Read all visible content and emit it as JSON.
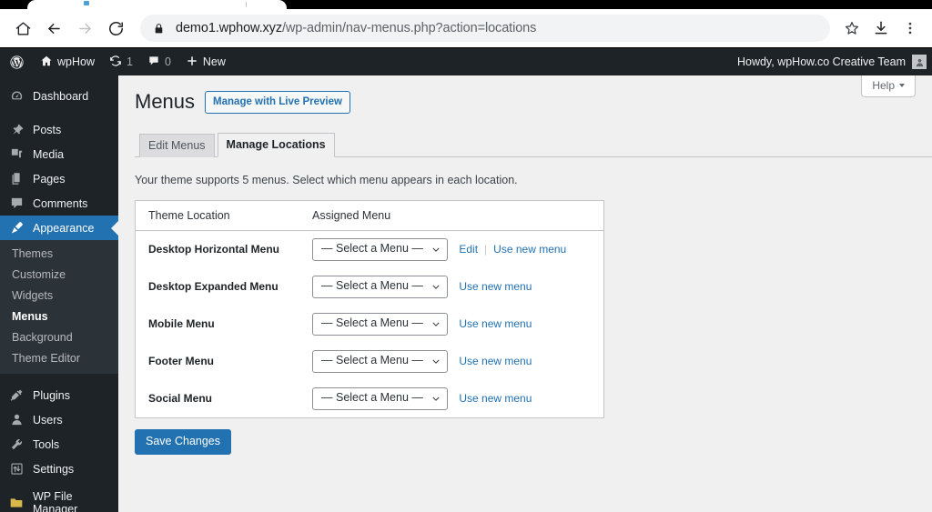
{
  "browser": {
    "url_host": "demo1.wphow.xyz",
    "url_path": "/wp-admin/nav-menus.php?action=locations",
    "icons": {
      "home": "home-icon",
      "back": "back-arrow-icon",
      "forward": "forward-arrow-icon",
      "reload": "reload-icon",
      "lock": "lock-icon",
      "bookmark": "star-icon",
      "download": "download-icon",
      "menu": "three-dot-menu-icon"
    }
  },
  "adminbar": {
    "logo": "wordpress-logo-icon",
    "site_name": "wpHow",
    "updates_count": "1",
    "comments_count": "0",
    "new_label": "New",
    "howdy": "Howdy, wpHow.co Creative Team"
  },
  "sidebar": {
    "items": [
      {
        "label": "Dashboard",
        "icon": "dashboard-icon",
        "current": false,
        "gap_after": true
      },
      {
        "label": "Posts",
        "icon": "pin-icon",
        "current": false,
        "gap_after": false
      },
      {
        "label": "Media",
        "icon": "media-icon",
        "current": false,
        "gap_after": false
      },
      {
        "label": "Pages",
        "icon": "pages-icon",
        "current": false,
        "gap_after": false
      },
      {
        "label": "Comments",
        "icon": "comments-icon",
        "current": false,
        "gap_after": false
      },
      {
        "label": "Appearance",
        "icon": "appearance-brush-icon",
        "current": true,
        "gap_after": false
      }
    ],
    "submenu": [
      {
        "label": "Themes",
        "current": false
      },
      {
        "label": "Customize",
        "current": false
      },
      {
        "label": "Widgets",
        "current": false
      },
      {
        "label": "Menus",
        "current": true
      },
      {
        "label": "Background",
        "current": false
      },
      {
        "label": "Theme Editor",
        "current": false
      }
    ],
    "items_after": [
      {
        "label": "Plugins",
        "icon": "plugins-plug-icon",
        "current": false
      },
      {
        "label": "Users",
        "icon": "users-icon",
        "current": false
      },
      {
        "label": "Tools",
        "icon": "tools-wrench-icon",
        "current": false
      },
      {
        "label": "Settings",
        "icon": "settings-sliders-icon",
        "current": false
      }
    ],
    "items_last": [
      {
        "label": "WP File Manager",
        "icon": "folder-icon",
        "current": false
      }
    ],
    "colors": {
      "background": "#1d2327",
      "submenu_background": "#2c3338",
      "current_highlight": "#2271b1",
      "folder_icon": "#d8b84a"
    }
  },
  "content": {
    "help_label": "Help",
    "page_title": "Menus",
    "live_preview_label": "Manage with Live Preview",
    "tabs": [
      {
        "label": "Edit Menus",
        "active": false
      },
      {
        "label": "Manage Locations",
        "active": true
      }
    ],
    "intro": "Your theme supports 5 menus. Select which menu appears in each location.",
    "table": {
      "headers": [
        "Theme Location",
        "Assigned Menu"
      ],
      "select_placeholder": "— Select a Menu —",
      "rows": [
        {
          "location": "Desktop Horizontal Menu",
          "selected": "— Select a Menu —",
          "edit_label": "Edit",
          "use_new_label": "Use new menu",
          "has_edit": true
        },
        {
          "location": "Desktop Expanded Menu",
          "selected": "— Select a Menu —",
          "edit_label": "",
          "use_new_label": "Use new menu",
          "has_edit": false
        },
        {
          "location": "Mobile Menu",
          "selected": "— Select a Menu —",
          "edit_label": "",
          "use_new_label": "Use new menu",
          "has_edit": false
        },
        {
          "location": "Footer Menu",
          "selected": "— Select a Menu —",
          "edit_label": "",
          "use_new_label": "Use new menu",
          "has_edit": false
        },
        {
          "location": "Social Menu",
          "selected": "— Select a Menu —",
          "edit_label": "",
          "use_new_label": "Use new menu",
          "has_edit": false
        }
      ]
    },
    "save_label": "Save Changes",
    "colors": {
      "accent": "#2271b1",
      "page_background": "#f0f0f1",
      "panel_background": "#ffffff"
    }
  }
}
